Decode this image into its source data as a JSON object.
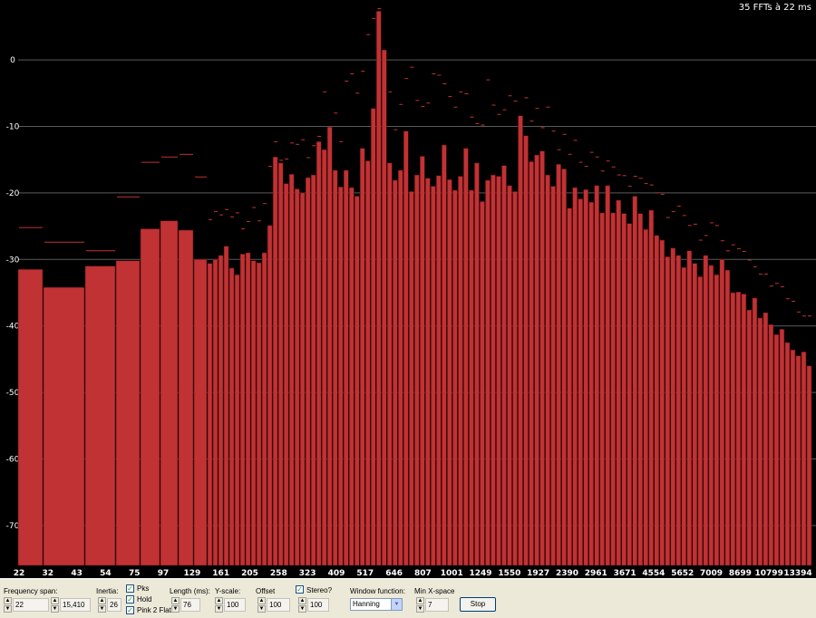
{
  "header": {
    "fft_info": "35 FFTs à 22 ms"
  },
  "colors": {
    "bar": "#c03234",
    "bar_edge": "#5a0d0d",
    "background": "#000000",
    "grid": "#5a5a5a",
    "peak": "#c03234"
  },
  "chart_data": {
    "type": "bar",
    "ylim": [
      -76,
      9
    ],
    "yticks": [
      0,
      -10,
      -20,
      -30,
      -40,
      -50,
      -60,
      -70
    ],
    "grid": true,
    "xtick_labels": [
      "22",
      "32",
      "43",
      "54",
      "75",
      "97",
      "129",
      "161",
      "205",
      "258",
      "323",
      "409",
      "517",
      "646",
      "807",
      "1001",
      "1249",
      "1550",
      "1927",
      "2390",
      "2961",
      "3671",
      "4554",
      "5652",
      "7009",
      "8699",
      "10799",
      "13394"
    ],
    "values": [
      -31.5,
      -34.2,
      -31.0,
      -30.2,
      -25.4,
      -24.2,
      -25.6,
      -30.0,
      -30.6,
      -30.0,
      -29.4,
      -28.0,
      -31.3,
      -32.3,
      -29.2,
      -29.0,
      -30.2,
      -30.5,
      -29.0,
      -24.9,
      -14.6,
      -15.5,
      -18.6,
      -17.2,
      -19.4,
      -20.0,
      -17.7,
      -17.3,
      -12.3,
      -13.5,
      -10.1,
      -16.6,
      -19.1,
      -16.6,
      -19.2,
      -20.5,
      -13.3,
      -15.2,
      -7.3,
      7.3,
      1.5,
      -15.5,
      -18.1,
      -16.6,
      -10.7,
      -19.8,
      -17.3,
      -14.5,
      -17.8,
      -19.0,
      -17.4,
      -12.8,
      -18.0,
      -19.6,
      -17.5,
      -13.3,
      -19.6,
      -15.5,
      -21.3,
      -18.1,
      -17.3,
      -17.5,
      -15.9,
      -18.9,
      -19.8,
      -8.4,
      -11.4,
      -15.3,
      -14.3,
      -13.7,
      -17.3,
      -19.0,
      -15.7,
      -16.4,
      -22.3,
      -19.2,
      -20.9,
      -19.5,
      -21.4,
      -18.9,
      -23.0,
      -18.9,
      -23.0,
      -21.1,
      -23.1,
      -24.6,
      -20.5,
      -23.1,
      -25.5,
      -22.6,
      -26.4,
      -27.1,
      -29.6,
      -28.3,
      -29.4,
      -31.2,
      -28.7,
      -30.6,
      -32.6,
      -29.4,
      -30.9,
      -32.3,
      -30.0,
      -31.6,
      -35.0,
      -34.9,
      -35.2,
      -37.6,
      -35.8,
      -38.8,
      -38.0,
      -39.8,
      -41.3,
      -40.5,
      -42.5,
      -43.6,
      -44.5,
      -43.9,
      -46.0
    ],
    "peaks": [
      -25.2,
      -27.4,
      -28.7,
      -20.6,
      -15.4,
      -14.6,
      -14.2,
      -17.6,
      -24.0,
      -22.8,
      -23.3,
      -22.5,
      -23.6,
      -23.0,
      -25.4,
      -24.3,
      -22.2,
      -24.2,
      -21.6,
      -16.0,
      -12.3,
      -15.1,
      -14.9,
      -12.5,
      -12.7,
      -12.0,
      -14.7,
      -12.9,
      -11.5,
      -4.8,
      -11.4,
      -8.0,
      -12.3,
      -3.2,
      -2.1,
      -5.0,
      -1.7,
      3.8,
      6.2,
      7.7,
      -2.2,
      -4.8,
      -10.5,
      -6.7,
      -2.8,
      -1.1,
      -6.1,
      -7.0,
      -6.5,
      -2.1,
      -2.3,
      -3.6,
      -5.5,
      -7.1,
      -4.8,
      -5.1,
      -8.6,
      -9.6,
      -9.8,
      -3.0,
      -6.8,
      -8.2,
      -7.5,
      -5.4,
      -6.2,
      -8.9,
      -5.7,
      -9.2,
      -7.3,
      -10.2,
      -7.1,
      -10.7,
      -13.5,
      -11.2,
      -14.2,
      -12.1,
      -15.4,
      -16.0,
      -13.9,
      -14.6,
      -16.7,
      -15.2,
      -16.1,
      -17.3,
      -17.4,
      -19.0,
      -17.5,
      -17.8,
      -18.6,
      -18.8,
      -20.0,
      -20.2,
      -23.7,
      -22.8,
      -22.0,
      -23.4,
      -24.9,
      -24.7,
      -27.1,
      -26.4,
      -24.5,
      -24.9,
      -27.2,
      -28.7,
      -27.8,
      -28.4,
      -28.8,
      -30.1,
      -31.1,
      -32.2,
      -32.2,
      -34.0,
      -33.6,
      -34.1,
      -35.9,
      -36.3,
      -37.9,
      -38.5,
      -38.5
    ]
  },
  "controls": {
    "frequency_span": {
      "label": "Frequency span:",
      "from": "22",
      "to": "15,410"
    },
    "inertia": {
      "label": "Inertia:",
      "value": "26"
    },
    "pks": {
      "label": "Pks",
      "checked": true
    },
    "hold": {
      "label": "Hold",
      "checked": true
    },
    "pink_flat": {
      "label": "Pink 2 Flat",
      "checked": true
    },
    "length": {
      "label": "Length (ms):",
      "value": "76"
    },
    "yscale": {
      "label": "Y-scale:",
      "value": "100"
    },
    "offset": {
      "label": "Offset",
      "value": "100"
    },
    "stereo": {
      "label": "Stereo?",
      "checked": true,
      "value": "100"
    },
    "window_function": {
      "label": "Window function:",
      "value": "Hanning"
    },
    "min_xspace": {
      "label": "Min X-space",
      "value": "7"
    },
    "stop_button": "Stop"
  }
}
